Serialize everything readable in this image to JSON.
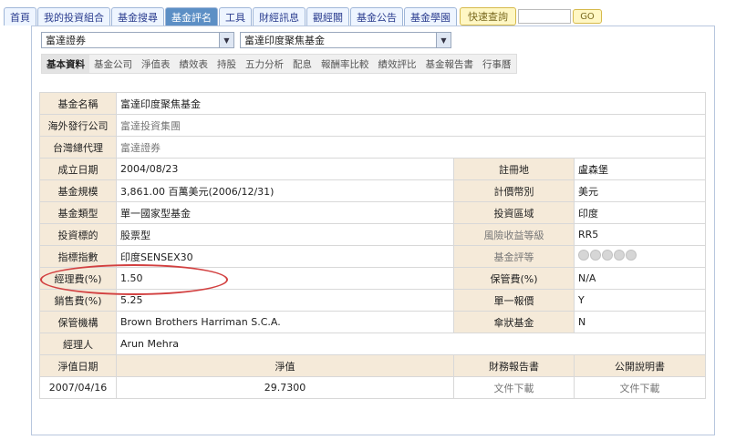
{
  "topnav": {
    "tabs": [
      "首頁",
      "我的投資組合",
      "基金搜尋",
      "基金評名",
      "工具",
      "財經訊息",
      "觀經閣",
      "基金公告",
      "基金學園"
    ],
    "active_index": 3,
    "quick_label": "快速查詢",
    "go_label": "GO"
  },
  "selects": {
    "company": "富達證券",
    "fund": "富達印度聚焦基金"
  },
  "subtabs": {
    "items": [
      "基本資料",
      "基金公司",
      "淨值表",
      "績效表",
      "持股",
      "五力分析",
      "配息",
      "報酬率比較",
      "績效評比",
      "基金報告書",
      "行事曆"
    ],
    "active_index": 0
  },
  "table": {
    "fund_name_label": "基金名稱",
    "fund_name": "富達印度聚焦基金",
    "issuer_label": "海外發行公司",
    "issuer": "富達投資集團",
    "agent_label": "台灣總代理",
    "agent": "富達證券",
    "inception_label": "成立日期",
    "inception": "2004/08/23",
    "domicile_label": "註冊地",
    "domicile": "盧森堡",
    "size_label": "基金規模",
    "size": "3,861.00 百萬美元(2006/12/31)",
    "currency_label": "計價幣別",
    "currency": "美元",
    "type_label": "基金類型",
    "type": "單一國家型基金",
    "region_label": "投資區域",
    "region": "印度",
    "target_label": "投資標的",
    "target": "股票型",
    "risk_label": "風險收益等級",
    "risk": "RR5",
    "index_label": "指標指數",
    "index": "印度SENSEX30",
    "rating_label": "基金評等",
    "rating_stars": 0,
    "mgmt_fee_label": "經理費(%)",
    "mgmt_fee": "1.50",
    "custody_fee_label": "保管費(%)",
    "custody_fee": "N/A",
    "sales_fee_label": "銷售費(%)",
    "sales_fee": "5.25",
    "single_label": "單一報價",
    "single": "Y",
    "custodian_label": "保管機構",
    "custodian": "Brown Brothers Harriman S.C.A.",
    "umbrella_label": "傘狀基金",
    "umbrella": "N",
    "manager_label": "經理人",
    "manager": "Arun Mehra",
    "nav_date_hdr": "淨值日期",
    "nav_hdr": "淨值",
    "report_hdr": "財務報告書",
    "prospectus_hdr": "公開說明書",
    "nav_date": "2007/04/16",
    "nav": "29.7300",
    "report_link": "文件下載",
    "prospectus_link": "文件下載"
  }
}
